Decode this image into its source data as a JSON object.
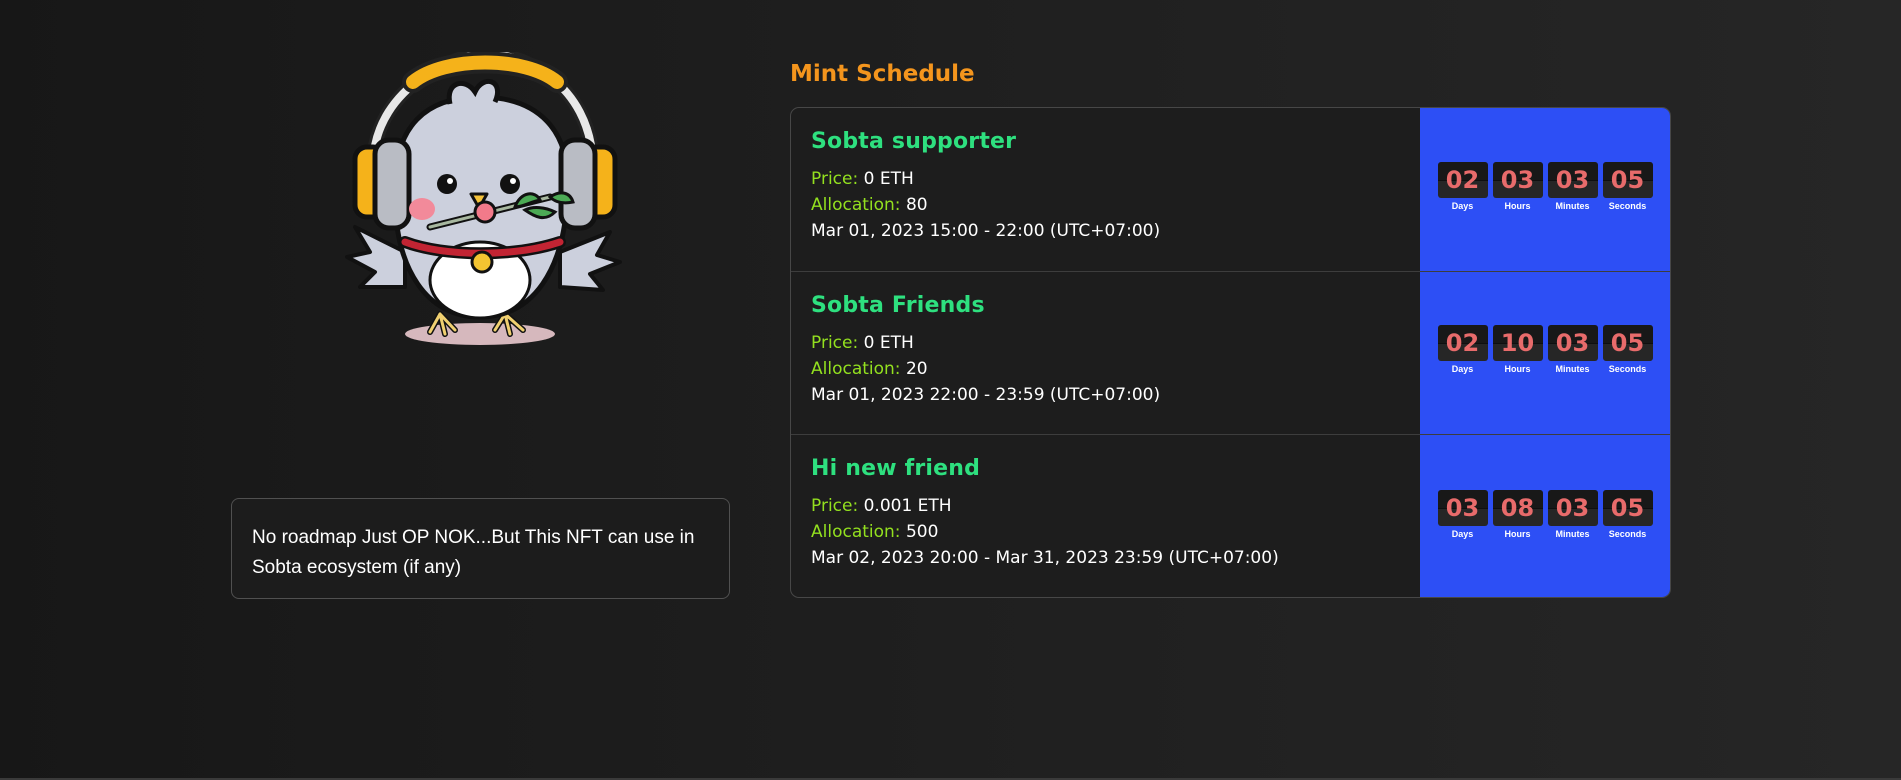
{
  "mint_schedule": {
    "title": "Mint Schedule",
    "price_key": "Price:",
    "allocation_key": "Allocation:",
    "timer_labels": {
      "days": "Days",
      "hours": "Hours",
      "minutes": "Minutes",
      "seconds": "Seconds"
    },
    "phases": [
      {
        "name": "Sobta supporter",
        "price": "0 ETH",
        "allocation": "80",
        "window": "Mar 01, 2023 15:00 - 22:00 (UTC+07:00)",
        "countdown": {
          "days": "02",
          "hours": "03",
          "minutes": "03",
          "seconds": "05"
        }
      },
      {
        "name": "Sobta Friends",
        "price": "0 ETH",
        "allocation": "20",
        "window": "Mar 01, 2023 22:00 - 23:59 (UTC+07:00)",
        "countdown": {
          "days": "02",
          "hours": "10",
          "minutes": "03",
          "seconds": "05"
        }
      },
      {
        "name": "Hi new friend",
        "price": "0.001 ETH",
        "allocation": "500",
        "window": "Mar 02, 2023 20:00 - Mar 31, 2023 23:59 (UTC+07:00)",
        "countdown": {
          "days": "03",
          "hours": "08",
          "minutes": "03",
          "seconds": "05"
        }
      }
    ]
  },
  "description": {
    "text": "No roadmap Just OP NOK...But This NFT can use in Sobta ecosystem (if any)"
  },
  "colors": {
    "background": "#1f1f1f",
    "title_orange": "#f4951d",
    "phase_name_green": "#2ee07f",
    "key_green": "#93e01f",
    "timer_blue": "#2d4ff5",
    "timer_digit": "#e86b6b"
  }
}
